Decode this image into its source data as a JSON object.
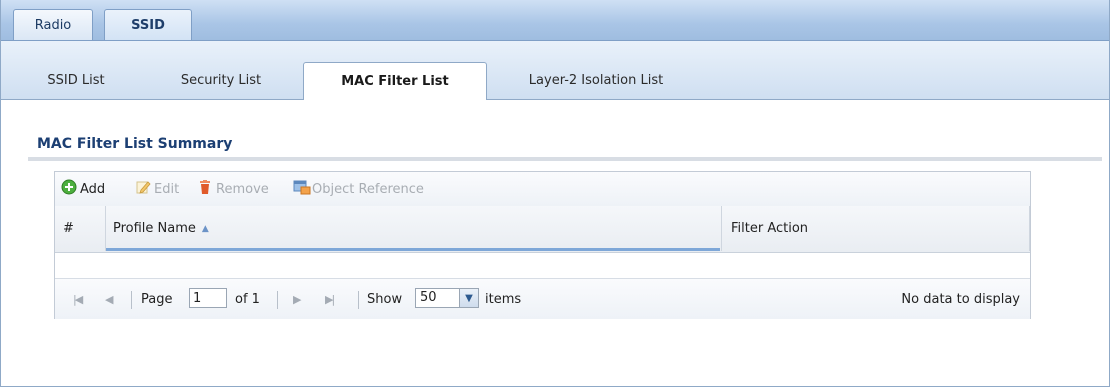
{
  "top_tabs": [
    {
      "label": "Radio",
      "active": false
    },
    {
      "label": "SSID",
      "active": true
    }
  ],
  "sub_tabs": [
    {
      "label": "SSID List",
      "active": false
    },
    {
      "label": "Security List",
      "active": false
    },
    {
      "label": "MAC Filter List",
      "active": true
    },
    {
      "label": "Layer-2 Isolation List",
      "active": false
    }
  ],
  "section": {
    "title": "MAC Filter List Summary"
  },
  "toolbar": {
    "add_label": "Add",
    "edit_label": "Edit",
    "remove_label": "Remove",
    "object_reference_label": "Object Reference"
  },
  "table": {
    "columns": [
      "#",
      "Profile Name",
      "Filter Action"
    ],
    "sort_indicator": "▲",
    "rows": []
  },
  "pager": {
    "page_label": "Page",
    "page_value": "1",
    "of_label": "of 1",
    "show_label": "Show",
    "show_value": "50",
    "items_label": "items",
    "status": "No data to display"
  },
  "colors": {
    "accent": "#1c3f73",
    "tab_strip": "#a9c5e6",
    "add_icon": "#4caf3e",
    "remove_icon": "#e05a2a"
  },
  "icons": {
    "add": "plus-circle-icon",
    "edit": "pencil-icon",
    "remove": "trash-icon",
    "object_reference": "object-reference-icon"
  }
}
